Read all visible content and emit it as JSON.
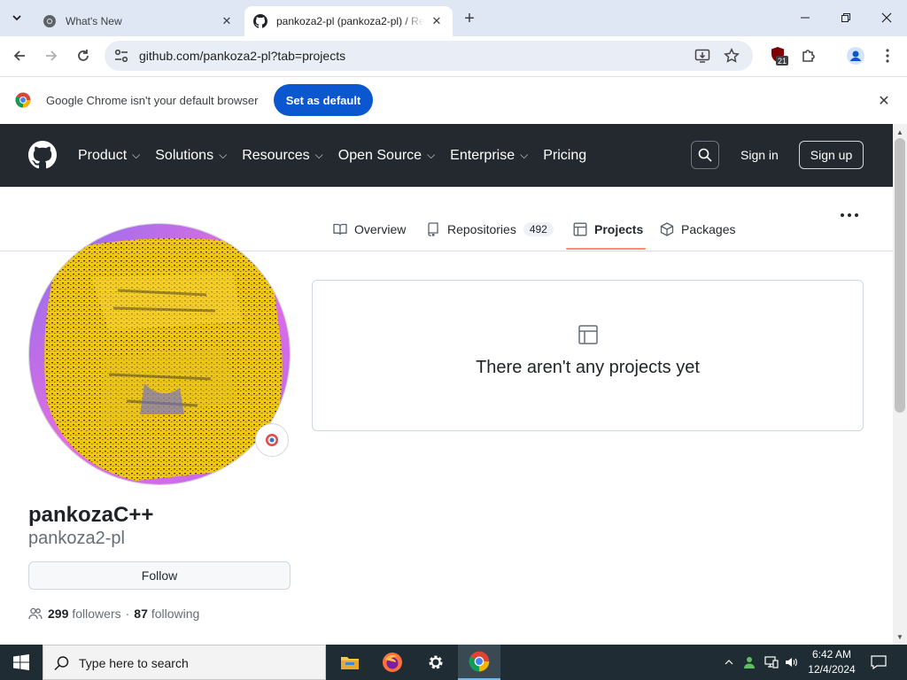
{
  "browser": {
    "tabs": [
      {
        "title": "What's New",
        "active": false
      },
      {
        "title": "pankoza2-pl (pankoza2-pl) / Re",
        "active": true
      }
    ],
    "url": "github.com/pankoza2-pl?tab=projects",
    "extension_badge": "21",
    "infobar": {
      "message": "Google Chrome isn't your default browser",
      "button": "Set as default"
    }
  },
  "github": {
    "nav": [
      {
        "label": "Product",
        "dropdown": true
      },
      {
        "label": "Solutions",
        "dropdown": true
      },
      {
        "label": "Resources",
        "dropdown": true
      },
      {
        "label": "Open Source",
        "dropdown": true
      },
      {
        "label": "Enterprise",
        "dropdown": true
      },
      {
        "label": "Pricing",
        "dropdown": false
      }
    ],
    "sign_in": "Sign in",
    "sign_up": "Sign up",
    "profile_tabs": [
      {
        "label": "Overview",
        "icon": "book-icon"
      },
      {
        "label": "Repositories",
        "icon": "repo-icon",
        "count": "492"
      },
      {
        "label": "Projects",
        "icon": "table-icon",
        "selected": true
      },
      {
        "label": "Packages",
        "icon": "package-icon"
      }
    ],
    "profile": {
      "display_name": "pankozaC++",
      "username": "pankoza2-pl",
      "follow_button": "Follow",
      "followers_count": "299",
      "followers_label": "followers",
      "separator": "·",
      "following_count": "87",
      "following_label": "following"
    },
    "blankslate": {
      "message": "There aren't any projects yet"
    }
  },
  "taskbar": {
    "search_placeholder": "Type here to search",
    "time": "6:42 AM",
    "date": "12/4/2024"
  },
  "colors": {
    "gh_header": "#24292f",
    "chrome_blue": "#0b57d0",
    "tab_underline": "#fd8c73"
  }
}
